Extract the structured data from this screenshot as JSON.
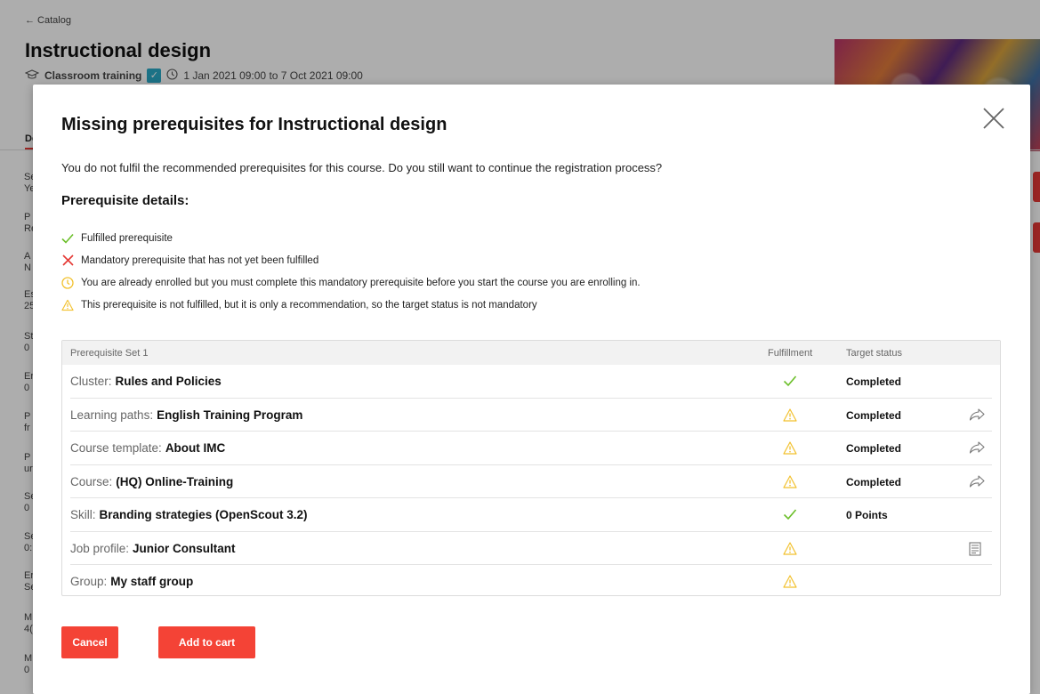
{
  "background": {
    "back_link": "← Catalog",
    "course_title": "Instructional design",
    "course_type": "Classroom training",
    "course_dates": "1 Jan 2021 09:00 to 7 Oct 2021 09:00",
    "tab_label": "De",
    "side_letters": [
      "Se",
      "Ye",
      "P",
      "Re",
      "A",
      "N",
      "Es",
      "25",
      "St",
      "0",
      "Er",
      "0",
      "P",
      "fr",
      "P",
      "ur",
      "Se",
      "0",
      "Se",
      "0:",
      "Er",
      "Se",
      "M",
      "4(",
      "M",
      "0"
    ]
  },
  "modal": {
    "title": "Missing prerequisites for Instructional design",
    "description": "You do not fulfil the recommended prerequisites for this course. Do you still want to continue the registration process?",
    "details_heading": "Prerequisite details:",
    "legend": [
      {
        "icon": "check-icon",
        "text": "Fulfilled prerequisite"
      },
      {
        "icon": "cross-icon",
        "text": "Mandatory prerequisite that has not yet been fulfilled"
      },
      {
        "icon": "clock-icon",
        "text": "You are already enrolled but you must complete this mandatory prerequisite before you start the course you are enrolling in."
      },
      {
        "icon": "warning-icon",
        "text": "This prerequisite is not fulfilled, but it is only a recommendation, so the target status is not mandatory"
      }
    ],
    "table": {
      "set_name": "Prerequisite Set 1",
      "col_fulfillment": "Fulfillment",
      "col_target_status": "Target status",
      "rows": [
        {
          "kind": "Cluster:",
          "value": "Rules and Policies",
          "fulfillment": "check",
          "status": "Completed",
          "action": ""
        },
        {
          "kind": "Learning paths:",
          "value": "English Training Program",
          "fulfillment": "warning",
          "status": "Completed",
          "action": "share"
        },
        {
          "kind": "Course template:",
          "value": "About IMC",
          "fulfillment": "warning",
          "status": "Completed",
          "action": "share"
        },
        {
          "kind": "Course:",
          "value": "(HQ) Online-Training",
          "fulfillment": "warning",
          "status": "Completed",
          "action": "share"
        },
        {
          "kind": "Skill:",
          "value": "Branding strategies (OpenScout 3.2)",
          "fulfillment": "check",
          "status": "0 Points",
          "action": ""
        },
        {
          "kind": "Job profile:",
          "value": "Junior Consultant",
          "fulfillment": "warning",
          "status": "",
          "action": "profile"
        },
        {
          "kind": "Group:",
          "value": "My staff group",
          "fulfillment": "warning",
          "status": "",
          "action": ""
        }
      ]
    },
    "buttons": {
      "cancel": "Cancel",
      "add_to_cart": "Add to cart"
    }
  },
  "colors": {
    "accent_red": "#f44336",
    "check_green": "#6cbf2a",
    "warning_yellow": "#f2c12e",
    "cross_red": "#e53935"
  }
}
